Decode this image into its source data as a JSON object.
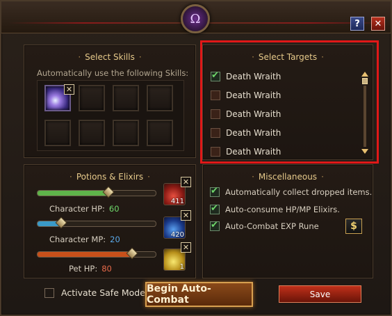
{
  "skills": {
    "title": "Select Skills",
    "subtitle": "Automatically use the following Skills:",
    "slots": [
      {
        "filled": true,
        "icon": "lightning-skill-icon"
      },
      {
        "filled": false
      },
      {
        "filled": false
      },
      {
        "filled": false
      },
      {
        "filled": false
      },
      {
        "filled": false
      },
      {
        "filled": false
      },
      {
        "filled": false
      }
    ],
    "remove_glyph": "✕"
  },
  "targets": {
    "title": "Select Targets",
    "items": [
      {
        "label": "Death Wraith",
        "checked": true
      },
      {
        "label": "Death Wraith",
        "checked": false
      },
      {
        "label": "Death Wraith",
        "checked": false
      },
      {
        "label": "Death Wraith",
        "checked": false
      },
      {
        "label": "Death Wraith",
        "checked": false
      }
    ]
  },
  "potions": {
    "title": "Potions & Elixirs",
    "bars": [
      {
        "label": "Character HP:",
        "value": "60",
        "value_color": "#6fd86a",
        "fraction": 0.6,
        "fill_color": "#5fb44a"
      },
      {
        "label": "Character MP:",
        "value": "20",
        "value_color": "#5aa8e8",
        "fraction": 0.2,
        "fill_color": "#3a9ac8"
      },
      {
        "label": "Pet HP:",
        "value": "80",
        "value_color": "#e86a4a",
        "fraction": 0.8,
        "fill_color": "#c8501a"
      }
    ],
    "items": [
      {
        "icon": "red-potion-icon",
        "count": "411"
      },
      {
        "icon": "blue-potion-icon",
        "count": "420"
      },
      {
        "icon": "yellow-elixir-icon",
        "count": "1"
      }
    ],
    "remove_glyph": "✕"
  },
  "misc": {
    "title": "Miscellaneous",
    "options": [
      {
        "label": "Automatically collect dropped items.",
        "checked": true
      },
      {
        "label": "Auto-consume HP/MP Elixirs.",
        "checked": true
      },
      {
        "label": "Auto-Combat EXP Rune",
        "checked": true
      }
    ],
    "shop_glyph": "$"
  },
  "footer": {
    "safe_mode_label": "Activate Safe Mode.",
    "safe_mode_checked": false,
    "begin_label": "Begin Auto-Combat",
    "save_label": "Save"
  },
  "window": {
    "emblem_glyph": "Ω",
    "help_glyph": "?",
    "close_glyph": "✕",
    "highlight_color": "#e01818"
  }
}
